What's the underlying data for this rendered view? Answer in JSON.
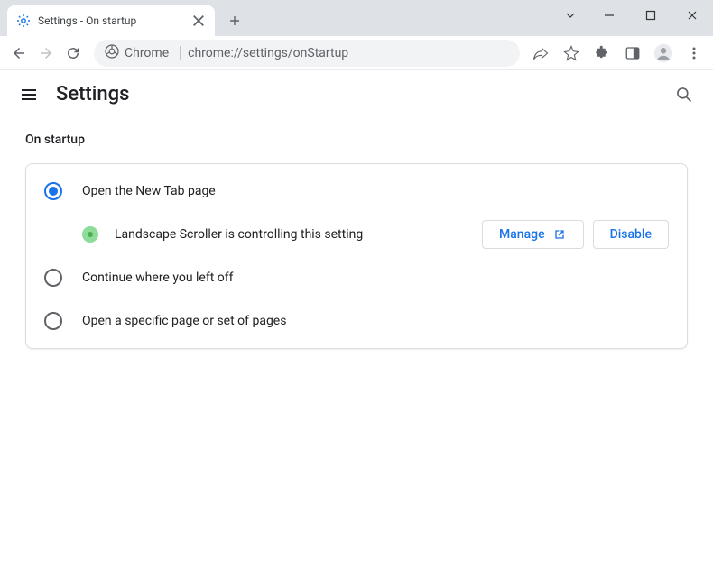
{
  "window": {
    "title": "Settings - On startup"
  },
  "omnibox": {
    "chip": "Chrome",
    "url": "chrome://settings/onStartup"
  },
  "header": {
    "title": "Settings"
  },
  "section": {
    "title": "On startup",
    "options": [
      {
        "label": "Open the New Tab page"
      },
      {
        "label": "Continue where you left off"
      },
      {
        "label": "Open a specific page or set of pages"
      }
    ],
    "controlled": {
      "text": "Landscape Scroller is controlling this setting",
      "manage": "Manage",
      "disable": "Disable"
    }
  }
}
